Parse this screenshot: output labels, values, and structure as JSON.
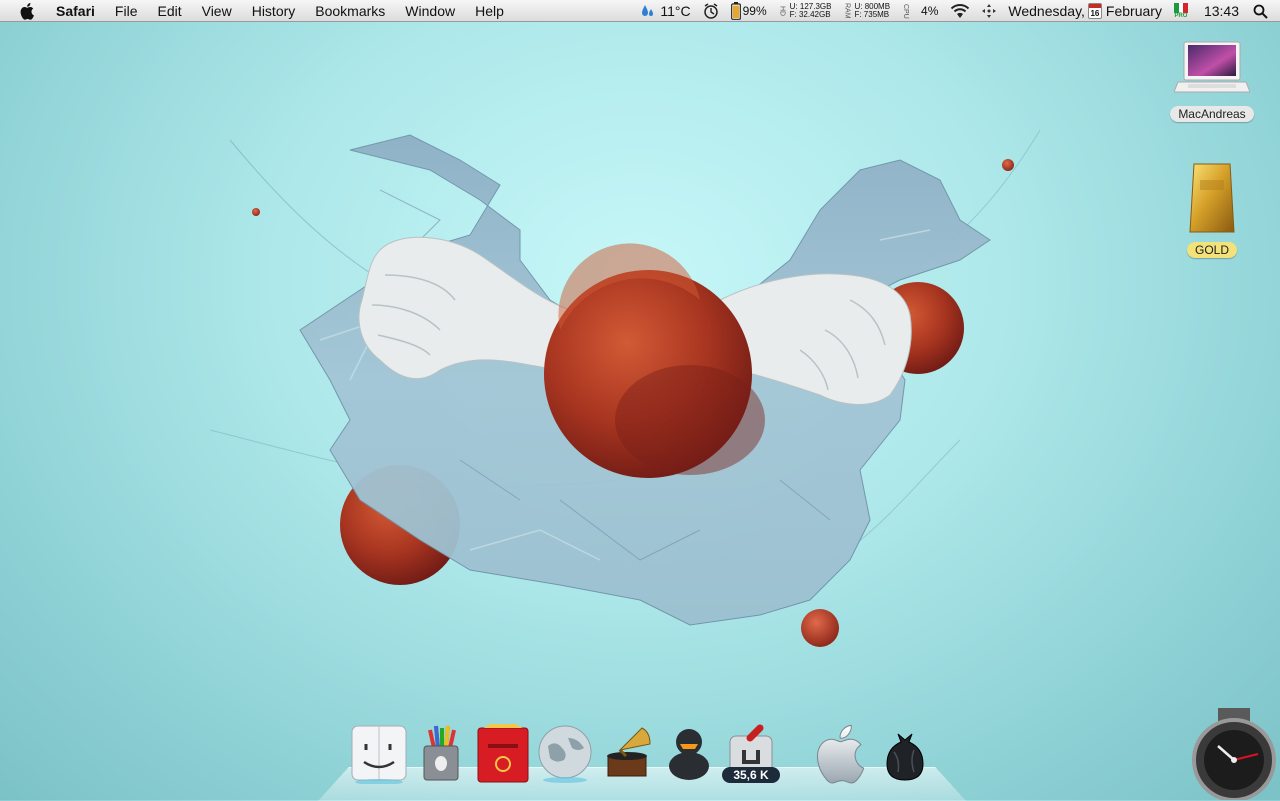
{
  "menubar": {
    "app_name": "Safari",
    "menus": [
      "File",
      "Edit",
      "View",
      "History",
      "Bookmarks",
      "Window",
      "Help"
    ],
    "weather": "11°C",
    "battery": "99%",
    "disk_used_label": "U:",
    "disk_used": "127.3GB",
    "disk_free_label": "F:",
    "disk_free": "32.42GB",
    "disk_side": "HD",
    "mem_used_label": "U:",
    "mem_used": "800MB",
    "mem_free_label": "F:",
    "mem_free": "735MB",
    "mem_side": "RAM",
    "cpu_side": "CPU",
    "cpu": "4%",
    "day": "Wednesday,",
    "calendar_day": "16",
    "month": "February",
    "flag_sub": "PRO",
    "time": "13:43"
  },
  "desktop": {
    "items": [
      {
        "label": "MacAndreas",
        "icon": "laptop-icon"
      },
      {
        "label": "GOLD",
        "icon": "gold-bar-icon"
      }
    ]
  },
  "dock": {
    "items": [
      "finder-icon",
      "pencil-cup-icon",
      "mailbox-icon",
      "globe-icon",
      "gramophone-icon",
      "duck-icon",
      "transmission-icon",
      "apple-icon",
      "trash-bag-icon"
    ],
    "badge": "35,6 K"
  },
  "colors": {
    "wallpaper": "#aee8ea",
    "sphere": "#b33a1f",
    "plastic": "#8fb4c8"
  }
}
